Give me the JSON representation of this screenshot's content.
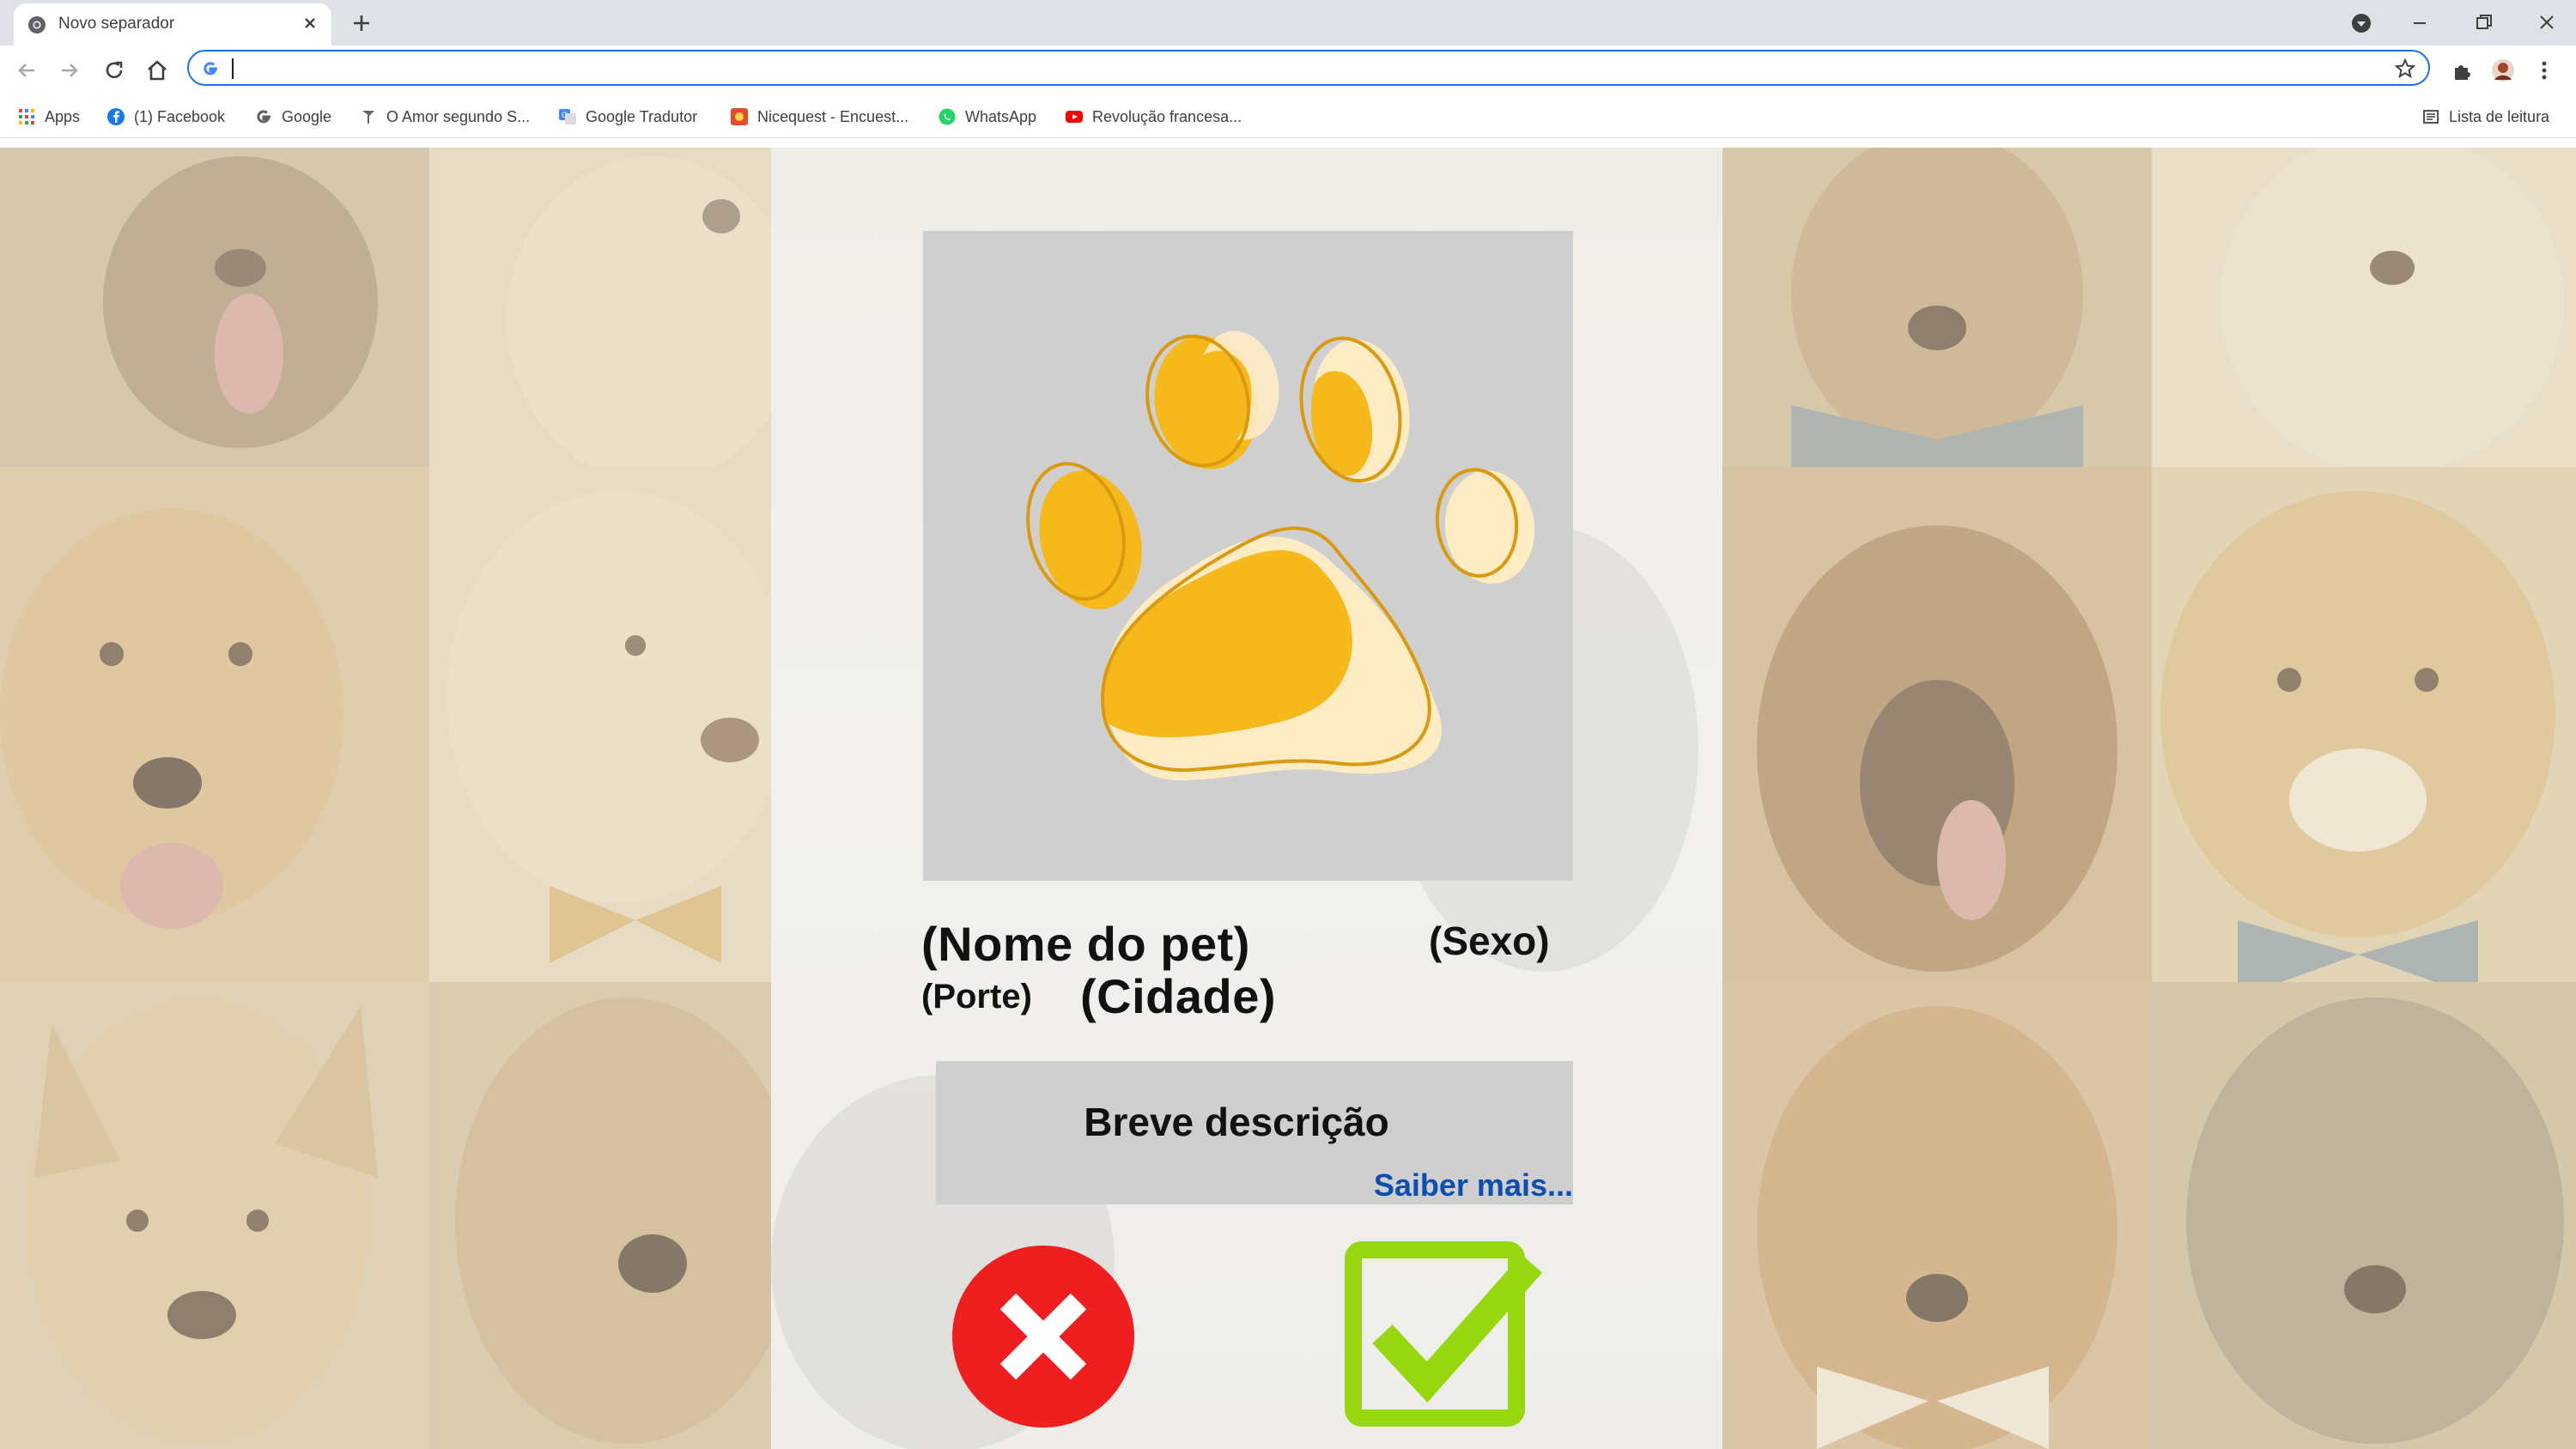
{
  "browser": {
    "tab": {
      "title": "Novo separador"
    },
    "omnibox": {
      "value": "",
      "placeholder": ""
    },
    "bookmarks": [
      {
        "label": "Apps",
        "icon": "apps-grid-icon"
      },
      {
        "label": "(1) Facebook",
        "icon": "facebook-icon"
      },
      {
        "label": "Google",
        "icon": "google-icon"
      },
      {
        "label": "O Amor segundo S...",
        "icon": "page-icon"
      },
      {
        "label": "Google Tradutor",
        "icon": "translate-icon"
      },
      {
        "label": "Nicequest - Encuest...",
        "icon": "nicequest-icon"
      },
      {
        "label": "WhatsApp",
        "icon": "whatsapp-icon"
      },
      {
        "label": "Revolução francesa...",
        "icon": "youtube-icon"
      }
    ],
    "reading_list": {
      "label": "Lista de leitura"
    }
  },
  "card": {
    "pet_name": "(Nome do pet)",
    "pet_sex": "(Sexo)",
    "pet_size": "(Porte)",
    "pet_city": "(Cidade)",
    "description": "Breve descrição",
    "more_link": "Saiber mais..."
  },
  "colors": {
    "accent_paw": "#f5b91c",
    "paw_outline": "#d99a10",
    "reject": "#f01f1f",
    "accept": "#96d70f",
    "link": "#0d4fb0",
    "omnibox_border": "#1a73e8"
  }
}
